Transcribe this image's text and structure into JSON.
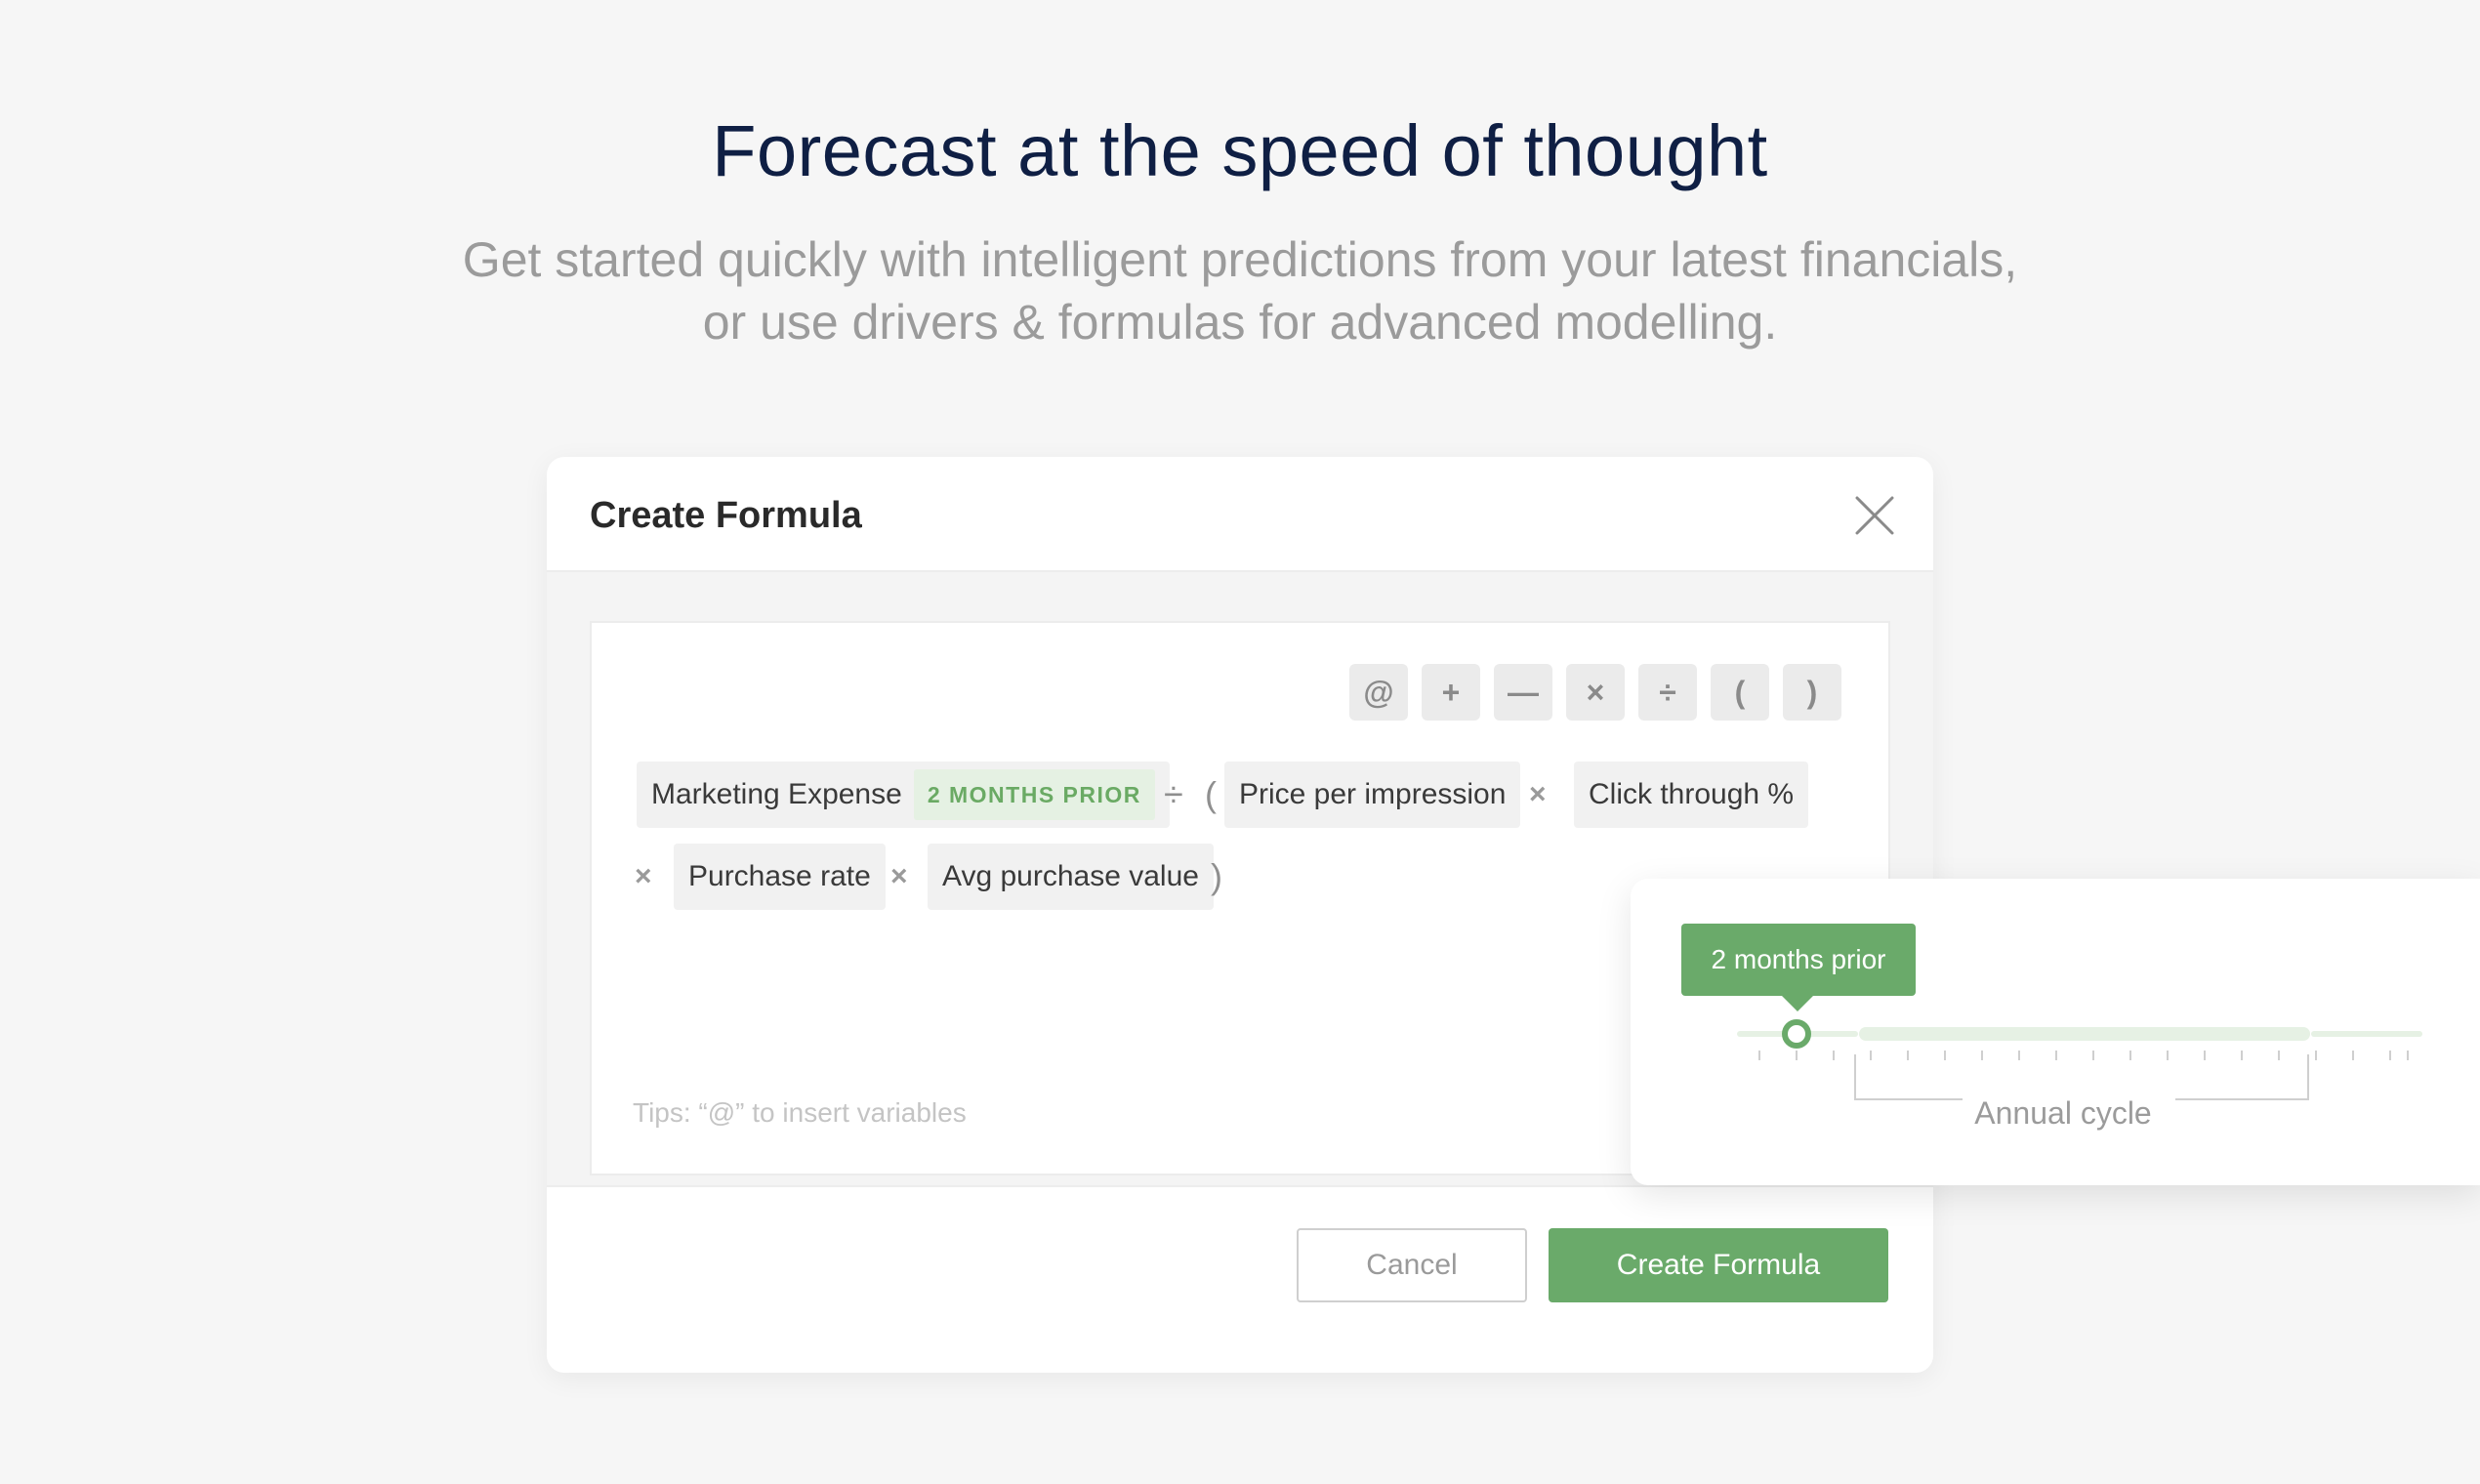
{
  "hero": {
    "title": "Forecast at the speed of thought",
    "subtitle_line1": "Get started quickly with intelligent predictions from your latest financials,",
    "subtitle_line2": "or use drivers & formulas for advanced modelling."
  },
  "modal": {
    "title": "Create Formula",
    "operators": [
      "@",
      "+",
      "—",
      "×",
      "÷",
      "(",
      ")"
    ],
    "formula": {
      "token_marketing": "Marketing Expense",
      "badge_prior": "2 MONTHS PRIOR",
      "sym_divide": "÷",
      "sym_open_paren": "(",
      "token_price": "Price per impression",
      "sym_mult1": "×",
      "token_ctr": "Click through %",
      "sym_mult2": "×",
      "token_purchase_rate": "Purchase rate",
      "sym_mult3": "×",
      "token_avg_purchase": "Avg purchase value",
      "sym_close_paren": ")"
    },
    "tips": "Tips: “@” to insert variables",
    "cancel_label": "Cancel",
    "create_label": "Create Formula"
  },
  "popover": {
    "tooltip": "2 months prior",
    "annual_label": "Annual cycle",
    "colors": {
      "accent": "#6aaa6a",
      "track": "#e6f1e4"
    }
  },
  "colors": {
    "title": "#0f1f44",
    "subtitle": "#9b9b9b",
    "accent_green": "#6aaa6a",
    "background": "#f6f6f6"
  }
}
